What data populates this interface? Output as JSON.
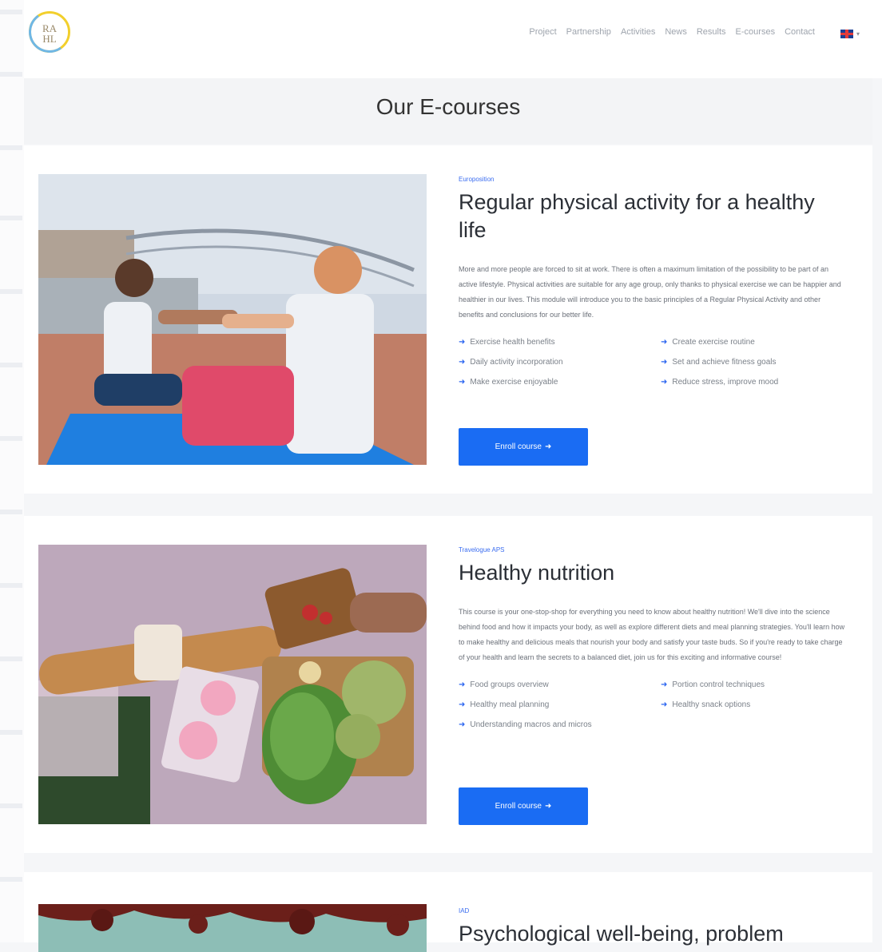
{
  "nav": {
    "items": [
      "Project",
      "Partnership",
      "Activities",
      "News",
      "Results",
      "E-courses",
      "Contact"
    ]
  },
  "logo": {
    "letters": "RA\nHL"
  },
  "page": {
    "title": "Our E-courses"
  },
  "colors": {
    "accent": "#1a6cf3",
    "category": "#3b6df0"
  },
  "courses": [
    {
      "category": "Europosition",
      "title": "Regular physical activity for a healthy life",
      "description": "More and more people are forced to sit at work. There is often a maximum limitation of the possibility to be part of an active lifestyle. Physical activities are suitable for any age group, only thanks to physical exercise we can be happier and healthier in our lives. This module will introduce you to the basic principles of a Regular Physical Activity and other benefits and conclusions for our better life.",
      "bullets": [
        "Exercise health benefits",
        "Create exercise routine",
        "Daily activity incorporation",
        "Set and achieve fitness goals",
        "Make exercise enjoyable",
        "Reduce stress, improve mood"
      ],
      "button": "Enroll course"
    },
    {
      "category": "Travelogue APS",
      "title": "Healthy nutrition",
      "description": "This course is your one-stop-shop for everything you need to know about healthy nutrition! We'll dive into the science behind food and how it impacts your body, as well as explore different diets and meal planning strategies. You'll learn how to make healthy and delicious meals that nourish your body and satisfy your taste buds. So if you're ready to take charge of your health and learn the secrets to a balanced diet, join us for this exciting and informative course!",
      "bullets": [
        "Food groups overview",
        "Portion control techniques",
        "Healthy meal planning",
        "Healthy snack options",
        "Understanding macros and micros"
      ],
      "button": "Enroll course"
    },
    {
      "category": "IAD",
      "title": "Psychological well-being, problem"
    }
  ]
}
